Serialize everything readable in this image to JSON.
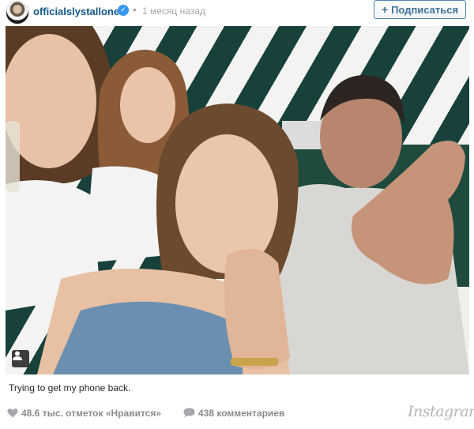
{
  "post": {
    "username": "officialslystallone",
    "verified_icon": "verified-check-icon",
    "separator": "•",
    "time_ago": "1 месяц назад",
    "follow_button": {
      "icon": "+",
      "label": "Подписаться"
    }
  },
  "caption": "Trying to get my phone back.",
  "stats": {
    "likes": "48.6 тыс. отметок «Нравится»",
    "comments": "438 комментариев"
  },
  "brand": "Instagram",
  "colors": {
    "username": "#125688",
    "follow_border": "#4e82ad",
    "follow_text": "#3f729b",
    "meta_text": "#a5a7aa",
    "stats_text": "#8a8a8a"
  }
}
